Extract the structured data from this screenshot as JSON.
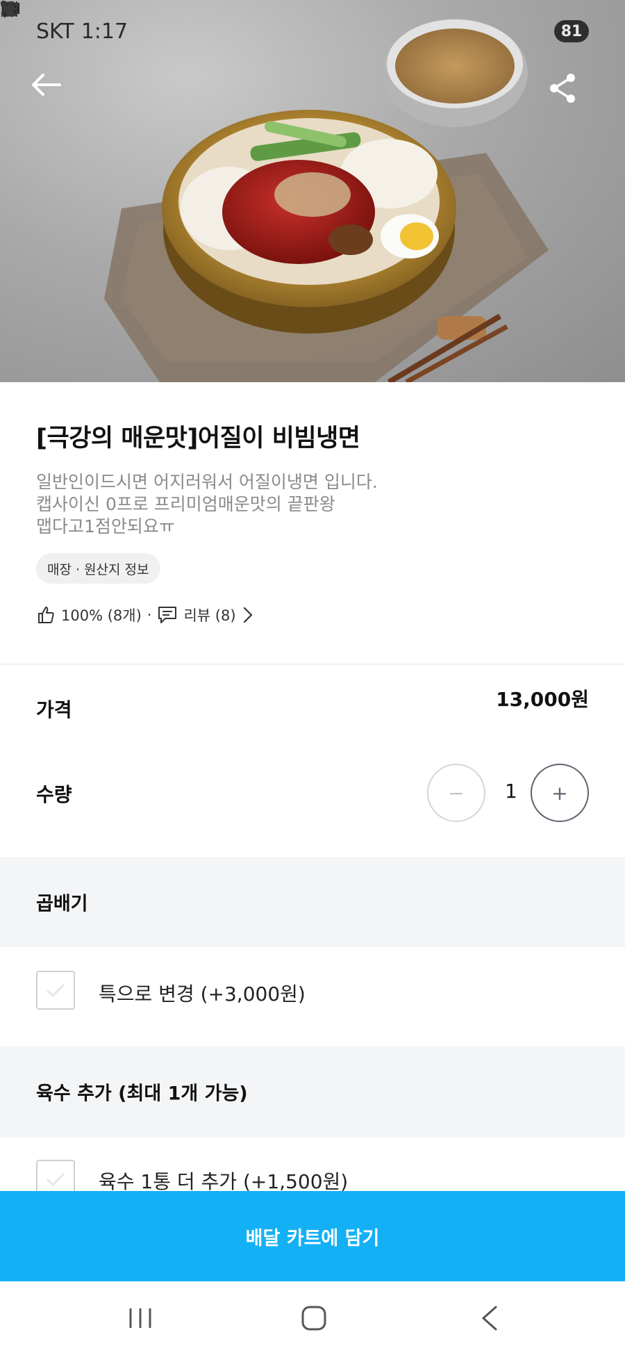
{
  "status_bar": {
    "carrier": "SKT",
    "time": "1:17",
    "battery": "81"
  },
  "product": {
    "title": "[극강의 매운맛]어질이 비빔냉면",
    "description_lines": [
      "일반인이드시면 어지러워서 어질이냉면 입니다.",
      "캡사이신 0프로 프리미엄매운맛의 끝판왕",
      "맵다고1점안되요ㅠ"
    ],
    "info_chip": "매장 · 원산지 정보",
    "like_rate": "100% (8개)",
    "separator": "·",
    "review_label": "리뷰 (8)"
  },
  "price": {
    "label": "가격",
    "value": "13,000원"
  },
  "quantity": {
    "label": "수량",
    "value": "1",
    "minus": "−",
    "plus": "+"
  },
  "option_groups": [
    {
      "title": "곱배기",
      "options": [
        {
          "label": "특으로 변경 (+3,000원)",
          "checked": false
        }
      ]
    },
    {
      "title": "육수 추가 (최대 1개 가능)",
      "options": [
        {
          "label": "육수 1통 더 추가 (+1,500원)",
          "checked": false
        }
      ]
    }
  ],
  "cta": {
    "label": "배달 카트에 담기",
    "color": "#14b0f5"
  },
  "icons": {
    "back": "back-arrow-icon",
    "share": "share-icon",
    "like": "thumbs-up-icon",
    "review": "chat-icon",
    "chevron": "chevron-right-icon"
  }
}
